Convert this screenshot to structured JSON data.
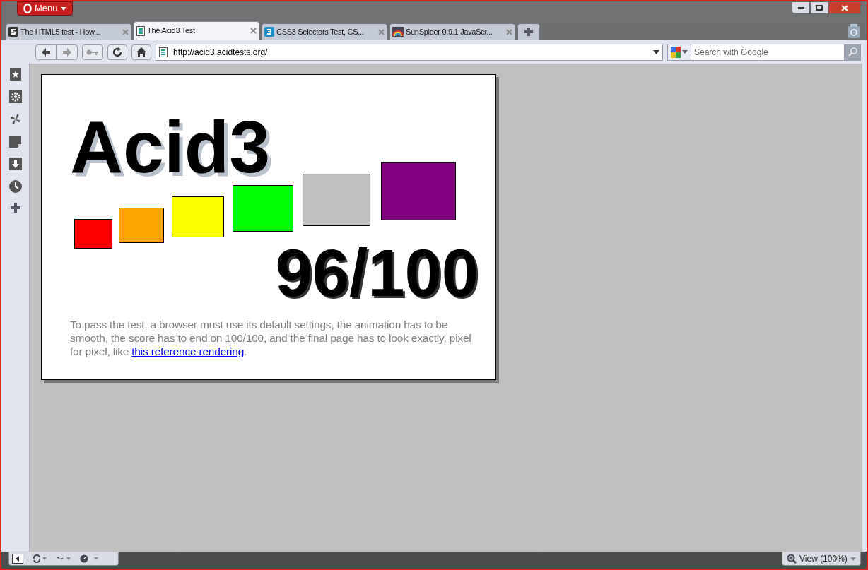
{
  "menu_button": {
    "label": "Menu"
  },
  "tabs": [
    {
      "label": "The HTML5 test - How...",
      "selected": false
    },
    {
      "label": "The Acid3 Test",
      "selected": true
    },
    {
      "label": "CSS3 Selectors Test, CS...",
      "selected": false
    },
    {
      "label": "SunSpider 0.9.1 JavaScr...",
      "selected": false
    }
  ],
  "address_bar": {
    "value": "http://acid3.acidtests.org/"
  },
  "search": {
    "placeholder": "Search with Google"
  },
  "page": {
    "title": "Acid3",
    "score": "96/100",
    "boxes": [
      {
        "color": "#ff0000"
      },
      {
        "color": "#ffa500"
      },
      {
        "color": "#ffff00"
      },
      {
        "color": "#00ff00"
      },
      {
        "color": "#c0c0c0"
      },
      {
        "color": "#800080"
      }
    ],
    "text": "To pass the test, a browser must use its default settings, the animation has to be smooth, the score has to end on 100/100, and the final page has to look exactly, pixel for pixel, like ",
    "link": "this reference rendering",
    "text_end": "."
  },
  "status_bar": {
    "zoom": "View (100%)"
  }
}
